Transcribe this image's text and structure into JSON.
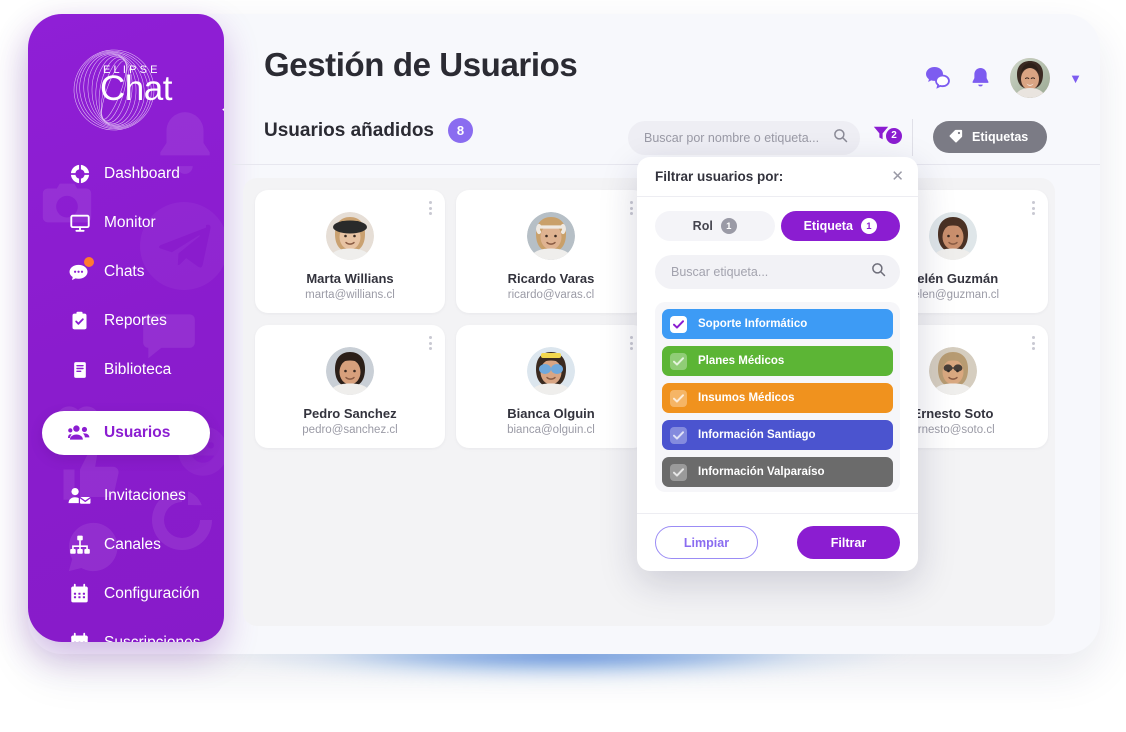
{
  "brand": {
    "logo_top": "ELIPSE",
    "logo_main": "Chat",
    "collapse_icon": "arrow-left-icon",
    "sidebar_color": "#8b1dd1"
  },
  "sidebar": {
    "items": [
      {
        "label": "Dashboard",
        "icon": "dashboard-icon",
        "active": false,
        "badge": false
      },
      {
        "label": "Monitor",
        "icon": "monitor-icon",
        "active": false,
        "badge": false
      },
      {
        "label": "Chats",
        "icon": "chat-icon",
        "active": false,
        "badge": true
      },
      {
        "label": "Reportes",
        "icon": "clipboard-check-icon",
        "active": false,
        "badge": false
      },
      {
        "label": "Biblioteca",
        "icon": "book-icon",
        "active": false,
        "badge": false
      },
      {
        "label": "Usuarios",
        "icon": "users-icon",
        "active": true,
        "badge": false
      },
      {
        "label": "Invitaciones",
        "icon": "user-mail-icon",
        "active": false,
        "badge": false
      },
      {
        "label": "Canales",
        "icon": "sitemap-icon",
        "active": false,
        "badge": false
      },
      {
        "label": "Configuración",
        "icon": "calendar-icon",
        "active": false,
        "badge": false
      },
      {
        "label": "Suscripciones",
        "icon": "calendar-icon",
        "active": false,
        "badge": false
      }
    ]
  },
  "header": {
    "title": "Gestión de Usuarios",
    "messages_icon": "chat-bubbles-icon",
    "notifications_icon": "bell-icon",
    "avatar": "user-avatar",
    "chevron_icon": "chevron-down-icon",
    "accent_color": "#7d5cf0"
  },
  "subheader": {
    "label": "Usuarios añadidos",
    "count": "8",
    "count_color": "#8a6cf0"
  },
  "search": {
    "placeholder": "Buscar por nombre o etiqueta...",
    "value": "",
    "icon": "search-icon"
  },
  "filter_indicator": {
    "icon": "filter-funnel-icon",
    "count": "2",
    "color": "#8b1dd1"
  },
  "tags_button": {
    "label": "Etiquetas",
    "icon": "tag-icon",
    "color": "#7b7b85"
  },
  "users": [
    {
      "name": "Marta Willians",
      "email": "marta@willians.cl",
      "menu_icon": "kebab-menu-icon"
    },
    {
      "name": "Ricardo Varas",
      "email": "ricardo@varas.cl",
      "menu_icon": "kebab-menu-icon"
    },
    {
      "name": "",
      "email": "",
      "menu_icon": "kebab-menu-icon"
    },
    {
      "name": "Belén Guzmán",
      "email": "belen@guzman.cl",
      "menu_icon": "kebab-menu-icon"
    },
    {
      "name": "Pedro Sanchez",
      "email": "pedro@sanchez.cl",
      "menu_icon": "kebab-menu-icon"
    },
    {
      "name": "Bianca Olguin",
      "email": "bianca@olguin.cl",
      "menu_icon": "kebab-menu-icon"
    },
    {
      "name": "",
      "email": "",
      "menu_icon": "kebab-menu-icon"
    },
    {
      "name": "Ernesto Soto",
      "email": "ernesto@soto.cl",
      "menu_icon": "kebab-menu-icon"
    }
  ],
  "filter_modal": {
    "title": "Filtrar usuarios por:",
    "close_icon": "close-icon",
    "tabs": [
      {
        "label": "Rol",
        "count": "1",
        "active": false
      },
      {
        "label": "Etiqueta",
        "count": "1",
        "active": true
      }
    ],
    "search": {
      "placeholder": "Buscar etiqueta...",
      "value": "",
      "icon": "search-icon"
    },
    "tags": [
      {
        "label": "Soporte Informático",
        "color": "#3d9bf5",
        "selected": true
      },
      {
        "label": "Planes Médicos",
        "color": "#5cb535",
        "selected": false
      },
      {
        "label": "Insumos Médicos",
        "color": "#f0921e",
        "selected": false
      },
      {
        "label": "Información Santiago",
        "color": "#4b54cf",
        "selected": false
      },
      {
        "label": "Información Valparaíso",
        "color": "#6b6b6b",
        "selected": false
      }
    ],
    "clear_label": "Limpiar",
    "apply_label": "Filtrar"
  }
}
